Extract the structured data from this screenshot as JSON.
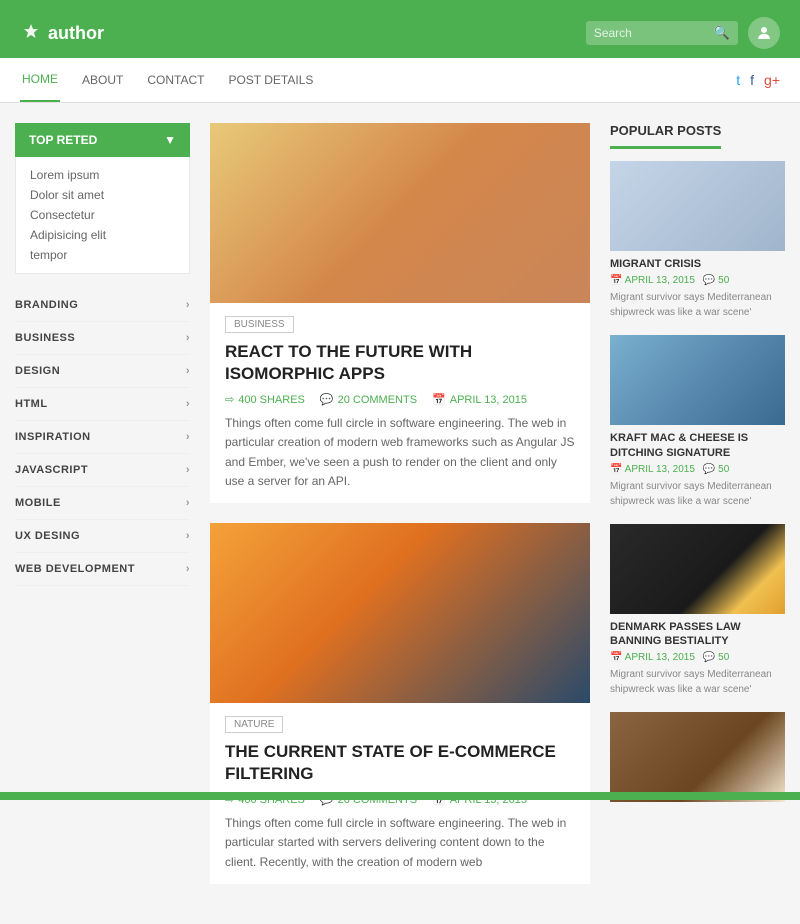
{
  "header": {
    "logo_text": "author",
    "search_placeholder": "Search",
    "user_icon": "👤"
  },
  "nav": {
    "links": [
      {
        "label": "HOME",
        "active": true
      },
      {
        "label": "ABOUT",
        "active": false
      },
      {
        "label": "CONTACT",
        "active": false
      },
      {
        "label": "POST DETAILS",
        "active": false
      }
    ],
    "social": [
      "t",
      "f",
      "g+"
    ]
  },
  "sidebar": {
    "top_rated_label": "TOP RETED",
    "top_rated_items": [
      "Lorem ipsum",
      "Dolor sit amet",
      "Consectetur",
      "Adipisicing elit",
      "tempor"
    ],
    "categories": [
      {
        "label": "BRANDING"
      },
      {
        "label": "BUSINESS"
      },
      {
        "label": "DESIGN"
      },
      {
        "label": "HTML"
      },
      {
        "label": "INSPIRATION"
      },
      {
        "label": "JAVASCRIPT"
      },
      {
        "label": "MOBILE"
      },
      {
        "label": "UX DESING"
      },
      {
        "label": "WEB DEVELOPMENT"
      }
    ]
  },
  "articles": [
    {
      "tag": "BUSINESS",
      "title": "REACT TO THE FUTURE WITH ISOMORPHIC APPS",
      "shares": "400 SHARES",
      "comments": "20 COMMENTS",
      "date": "APRIL 13, 2015",
      "excerpt": "Things often come full circle in software engineering. The web in particular creation of modern web frameworks such as Angular JS and Ember, we've seen a push to render on the client and only use a server for an API.",
      "img_class": "img-food"
    },
    {
      "tag": "NATURE",
      "title": "THE CURRENT STATE OF E-COMMERCE FILTERING",
      "shares": "400 SHARES",
      "comments": "20 COMMENTS",
      "date": "APRIL 13, 2015",
      "excerpt": "Things often come full circle in software engineering. The web in particular started with servers delivering content down to the client. Recently, with the creation of modern web",
      "img_class": "img-bottles"
    }
  ],
  "popular_posts": {
    "title": "POPULAR POSTS",
    "items": [
      {
        "title": "MIGRANT CRISIS",
        "date": "APRIL 13, 2015",
        "comments": "50",
        "excerpt": "Migrant survivor says Mediterranean shipwreck was like a war scene'",
        "img_class": "img-laptop"
      },
      {
        "title": "KRAFT MAC & CHEESE IS DITCHING SIGNATURE",
        "date": "APRIL 13, 2015",
        "comments": "50",
        "excerpt": "Migrant survivor says Mediterranean shipwreck was like a war scene'",
        "img_class": "img-mountains"
      },
      {
        "title": "DENMARK PASSES LAW BANNING BESTIALITY",
        "date": "APRIL 13, 2015",
        "comments": "50",
        "excerpt": "Migrant survivor says Mediterranean shipwreck was like a war scene'",
        "img_class": "img-tent"
      },
      {
        "img_class": "img-coffee",
        "title": "",
        "date": "",
        "comments": "",
        "excerpt": ""
      }
    ]
  }
}
